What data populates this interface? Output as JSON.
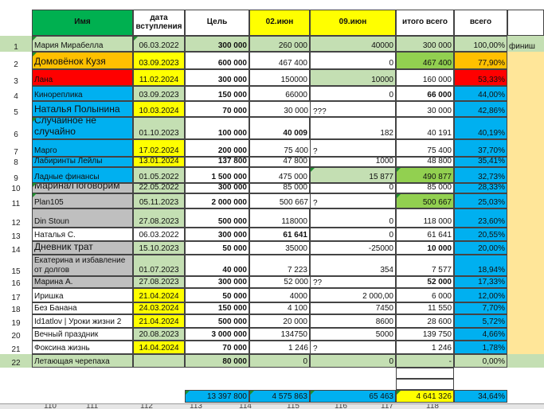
{
  "headers": {
    "name": "Имя",
    "date_joined": "дата вступления",
    "goal": "Цель",
    "week1": "02.июн",
    "week2": "09.июн",
    "total": "итого всего",
    "percent": "всего"
  },
  "rows": [
    {
      "num": "1",
      "name": "Мария Мирабелла",
      "date": "06.03.2022",
      "goal": "300 000",
      "w1": "260 000",
      "w2": "40000",
      "total": "300 000",
      "pct": "100,00%",
      "note": "финиш"
    },
    {
      "num": "2",
      "name": "Домовёнок Кузя",
      "date": "03.09.2023",
      "goal": "600 000",
      "w1": "467 400",
      "w2": "0",
      "total": "467 400",
      "pct": "77,90%",
      "note": ""
    },
    {
      "num": "3",
      "name": "Лана",
      "date": "11.02.2024",
      "goal": "300 000",
      "w1": "150000",
      "w2": "10000",
      "total": "160 000",
      "pct": "53,33%",
      "note": ""
    },
    {
      "num": "4",
      "name": "Кинореплика",
      "date": "03.09.2023",
      "goal": "150 000",
      "w1": "66000",
      "w2": "0",
      "total": "66 000",
      "pct": "44,00%",
      "note": ""
    },
    {
      "num": "5",
      "name": "Наталья Полынина",
      "date": "10.03.2024",
      "goal": "70 000",
      "w1": "30 000",
      "w1_mark": "???",
      "w2": "",
      "total": "30 000",
      "pct": "42,86%",
      "note": ""
    },
    {
      "num": "6",
      "name": "Случайное не случайно",
      "date": "01.10.2023",
      "goal": "100 000",
      "w1": "40 009",
      "w2": "182",
      "total": "40 191",
      "pct": "40,19%",
      "note": ""
    },
    {
      "num": "7",
      "name": "Марго",
      "date": "17.02.2024",
      "goal": "200 000",
      "w1": "75 400",
      "w1_mark": "?",
      "w2": "",
      "total": "75 400",
      "pct": "37,70%",
      "note": ""
    },
    {
      "num": "8",
      "name": "Лабиринты Лейлы",
      "date": "13.01.2024",
      "goal": "137 800",
      "w1": "47 800",
      "w2": "1000",
      "total": "48 800",
      "pct": "35,41%",
      "note": ""
    },
    {
      "num": "9",
      "name": "Ладные финансы",
      "date": "01.05.2022",
      "goal": "1 500 000",
      "w1": "475 000",
      "w2": "15 877",
      "total": "490 877",
      "pct": "32,73%",
      "note": ""
    },
    {
      "num": "10",
      "name": "Марина/Поговорим",
      "date": "22.05.2022",
      "goal": "300 000",
      "w1": "85 000",
      "w2": "0",
      "total": "85 000",
      "pct": "28,33%",
      "note": ""
    },
    {
      "num": "11",
      "name": "Plan105",
      "date": "05.11.2023",
      "goal": "2 000 000",
      "w1": "500 667",
      "w1_mark": "?",
      "w2": "",
      "total": "500 667",
      "pct": "25,03%",
      "note": ""
    },
    {
      "num": "12",
      "name": "Din Stoun",
      "date": "27.08.2023",
      "goal": "500 000",
      "w1": "118000",
      "w2": "0",
      "total": "118 000",
      "pct": "23,60%",
      "note": ""
    },
    {
      "num": "13",
      "name": "Наталья С.",
      "date": "06.03.2022",
      "goal": "300 000",
      "w1": "61 641",
      "w2": "0",
      "total": "61 641",
      "pct": "20,55%",
      "note": ""
    },
    {
      "num": "14",
      "name": "Дневник трат",
      "date": "15.10.2023",
      "goal": "50 000",
      "w1": "35000",
      "w2": "-25000",
      "total": "10 000",
      "pct": "20,00%",
      "note": ""
    },
    {
      "num": "15",
      "name": "Екатерина и избавление от долгов",
      "date": "01.07.2023",
      "goal": "40 000",
      "w1": "7 223",
      "w2": "354",
      "total": "7 577",
      "pct": "18,94%",
      "note": ""
    },
    {
      "num": "16",
      "name": "Марина А.",
      "date": "27.08.2023",
      "goal": "300 000",
      "w1": "52 000",
      "w1_mark": "??",
      "w2": "",
      "total": "52 000",
      "pct": "17,33%",
      "note": ""
    },
    {
      "num": "17",
      "name": "Иришка",
      "date": "21.04.2024",
      "goal": "50 000",
      "w1": "4000",
      "w2": "2 000,00",
      "total": "6 000",
      "pct": "12,00%",
      "note": ""
    },
    {
      "num": "18",
      "name": "Без Банана",
      "date": "24.03.2024",
      "goal": "150 000",
      "w1": "4 100",
      "w2": "7450",
      "total": "11 550",
      "pct": "7,70%",
      "note": ""
    },
    {
      "num": "19",
      "name": "Id1atlov |  Уроки жизни 2",
      "date": "21.04.2024",
      "goal": "500 000",
      "w1": "20 000",
      "w2": "8600",
      "total": "28 600",
      "pct": "5,72%",
      "note": ""
    },
    {
      "num": "20",
      "name": "Вечный праздник",
      "date": "20.08.2023",
      "goal": "3 000 000",
      "w1": "134750",
      "w2": "5000",
      "total": "139 750",
      "pct": "4,66%",
      "note": ""
    },
    {
      "num": "21",
      "name": "Фоксина жизнь",
      "date": "14.04.2024",
      "goal": "70 000",
      "w1": "1 246",
      "w1_mark": "?",
      "w2": "",
      "total": "1 246",
      "pct": "1,78%",
      "note": ""
    },
    {
      "num": "22",
      "name": "Летающая черепаха",
      "date": "",
      "goal": "80 000",
      "w1": "0",
      "w2": "0",
      "total": "-",
      "pct": "0,00%",
      "note": ""
    }
  ],
  "totals": {
    "goal": "13 397 800",
    "w1": "4 575 863",
    "w2": "65 463",
    "total": "4 641 326",
    "pct": "34,64%"
  },
  "colors": {
    "green_header": "#00b050",
    "yellow": "#ffff00",
    "blue": "#00b0f0",
    "orange": "#ffc000",
    "red": "#ff0000",
    "grey": "#bfbfbf",
    "light_green": "#c4dfb3",
    "bright_green": "#92d050",
    "peach": "#ffe699",
    "dark_blue": "#0070c0"
  },
  "row_headers": [
    "110",
    "111",
    "112",
    "113",
    "114",
    "115",
    "116",
    "117",
    "118"
  ]
}
